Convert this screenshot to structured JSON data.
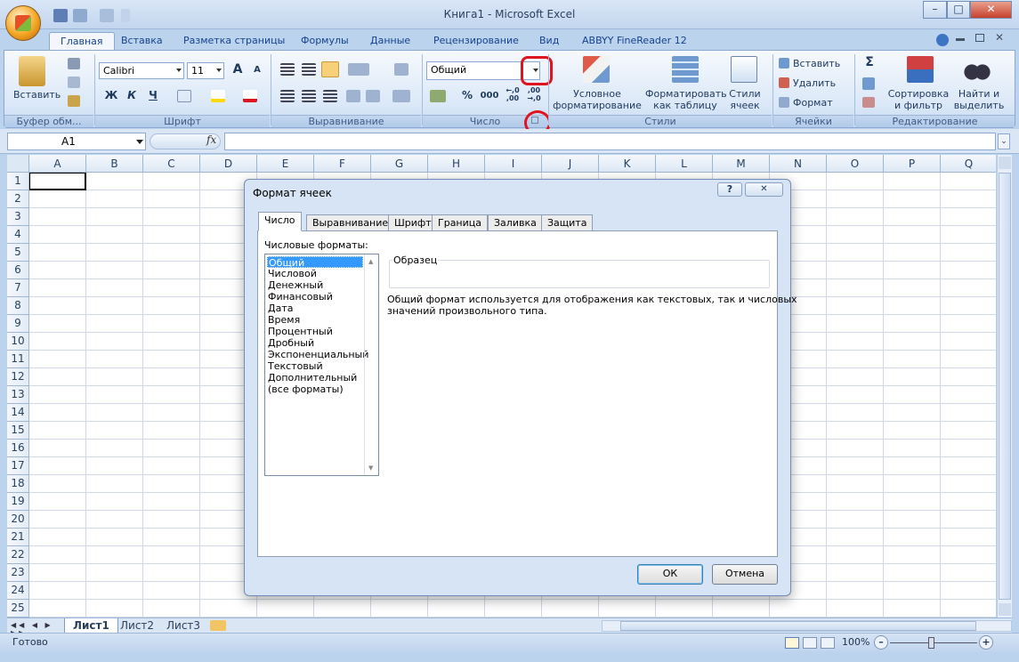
{
  "window": {
    "title": "Книга1 - Microsoft Excel",
    "minimize": "–",
    "maximize": "□",
    "close": "✕"
  },
  "ribbon_tabs": [
    "Главная",
    "Вставка",
    "Разметка страницы",
    "Формулы",
    "Данные",
    "Рецензирование",
    "Вид",
    "ABBYY FineReader 12"
  ],
  "ribbon": {
    "clipboard": {
      "paste": "Вставить",
      "label": "Буфер обм..."
    },
    "font": {
      "name": "Calibri",
      "size": "11",
      "grow": "A",
      "shrink": "A",
      "bold": "Ж",
      "italic": "К",
      "underline": "Ч",
      "label": "Шрифт"
    },
    "alignment": {
      "label": "Выравнивание"
    },
    "number": {
      "format": "Общий",
      "percent": "%",
      "thousands": "000",
      "inc_dec": "←,0 ,00",
      "dec_dec": ",00 →,0",
      "label": "Число"
    },
    "styles": {
      "conditional": "Условное",
      "conditional2": "форматирование",
      "as_table": "Форматировать",
      "as_table2": "как таблицу",
      "cell_styles": "Стили",
      "cell_styles2": "ячеек",
      "label": "Стили"
    },
    "cells": {
      "insert": "Вставить",
      "delete": "Удалить",
      "format": "Формат",
      "label": "Ячейки"
    },
    "editing": {
      "sum": "Σ",
      "sort": "Сортировка",
      "sort2": "и фильтр",
      "find": "Найти и",
      "find2": "выделить",
      "label": "Редактирование"
    }
  },
  "formula_bar": {
    "name_box": "A1",
    "fx": "fx",
    "value": ""
  },
  "columns": [
    "A",
    "B",
    "C",
    "D",
    "E",
    "F",
    "G",
    "H",
    "I",
    "J",
    "K",
    "L",
    "M",
    "N",
    "O",
    "P",
    "Q"
  ],
  "rows": [
    "1",
    "2",
    "3",
    "4",
    "5",
    "6",
    "7",
    "8",
    "9",
    "10",
    "11",
    "12",
    "13",
    "14",
    "15",
    "16",
    "17",
    "18",
    "19",
    "20",
    "21",
    "22",
    "23",
    "24",
    "25"
  ],
  "sheets": [
    "Лист1",
    "Лист2",
    "Лист3"
  ],
  "status": {
    "text": "Готово",
    "zoom": "100%",
    "zoom_minus": "–",
    "zoom_plus": "+"
  },
  "dialog": {
    "title": "Формат ячеек",
    "help": "?",
    "close": "✕",
    "tabs": [
      "Число",
      "Выравнивание",
      "Шрифт",
      "Граница",
      "Заливка",
      "Защита"
    ],
    "formats_label": "Числовые форматы:",
    "formats": [
      "Общий",
      "Числовой",
      "Денежный",
      "Финансовый",
      "Дата",
      "Время",
      "Процентный",
      "Дробный",
      "Экспоненциальный",
      "Текстовый",
      "Дополнительный",
      "(все форматы)"
    ],
    "selected_format": "Общий",
    "sample_label": "Образец",
    "description_line1": "Общий формат используется для отображения как текстовых, так и числовых",
    "description_line2": "значений произвольного типа.",
    "ok": "ОК",
    "cancel": "Отмена"
  },
  "colors": {
    "accent_red": "#e0141e",
    "selection_blue": "#3399ff",
    "ribbon_bg": "#dbe8f8"
  }
}
